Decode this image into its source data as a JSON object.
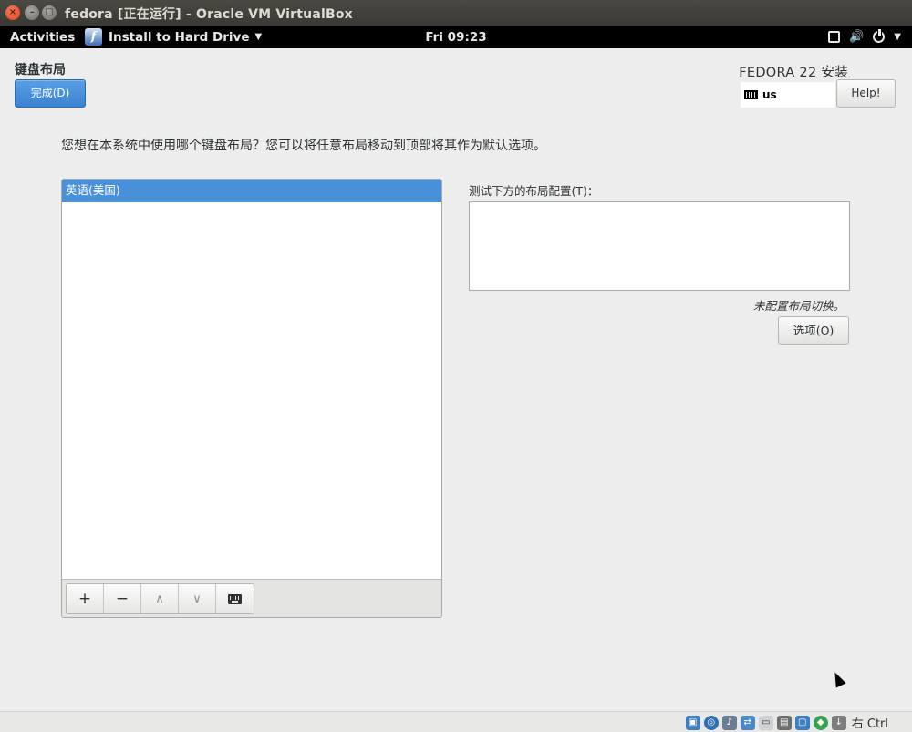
{
  "vbox": {
    "title": "fedora [正在运行] - Oracle VM VirtualBox",
    "close_glyph": "×",
    "min_glyph": "–",
    "max_glyph": "□",
    "host_key": "右 Ctrl"
  },
  "gnome": {
    "activities": "Activities",
    "app_name": "Install to Hard Drive",
    "app_arrow": "▼",
    "app_icon_glyph": "f",
    "clock": "Fri 09:23",
    "tray_arrow": "▼"
  },
  "installer": {
    "spoke_title": "键盘布局",
    "done_label": "完成(D)",
    "product": "FEDORA 22 安装",
    "keyboard_indicator": "us",
    "help_label": "Help!",
    "instruction": "您想在本系统中使用哪个键盘布局？您可以将任意布局移动到顶部将其作为默认选项。",
    "layouts": [
      {
        "label": "英语(美国)",
        "selected": true
      }
    ],
    "toolbar": {
      "add": "+",
      "remove": "−",
      "up": "∧",
      "down": "∨"
    },
    "test_label": "测试下方的布局配置(T)：",
    "test_value": "",
    "switch_note": "未配置布局切换。",
    "options_label": "选项(O)"
  },
  "icons": [
    "hdd-icon",
    "optical-drive-icon",
    "audio-icon",
    "network-icon",
    "usb-icon",
    "shared-folder-icon",
    "video-capture-icon",
    "mouse-integration-icon",
    "arrow-icon"
  ],
  "colors": {
    "accent": "#4a90d9",
    "done_button": "#3a83d2",
    "topbar": "#000000",
    "content_bg": "#ededed"
  }
}
